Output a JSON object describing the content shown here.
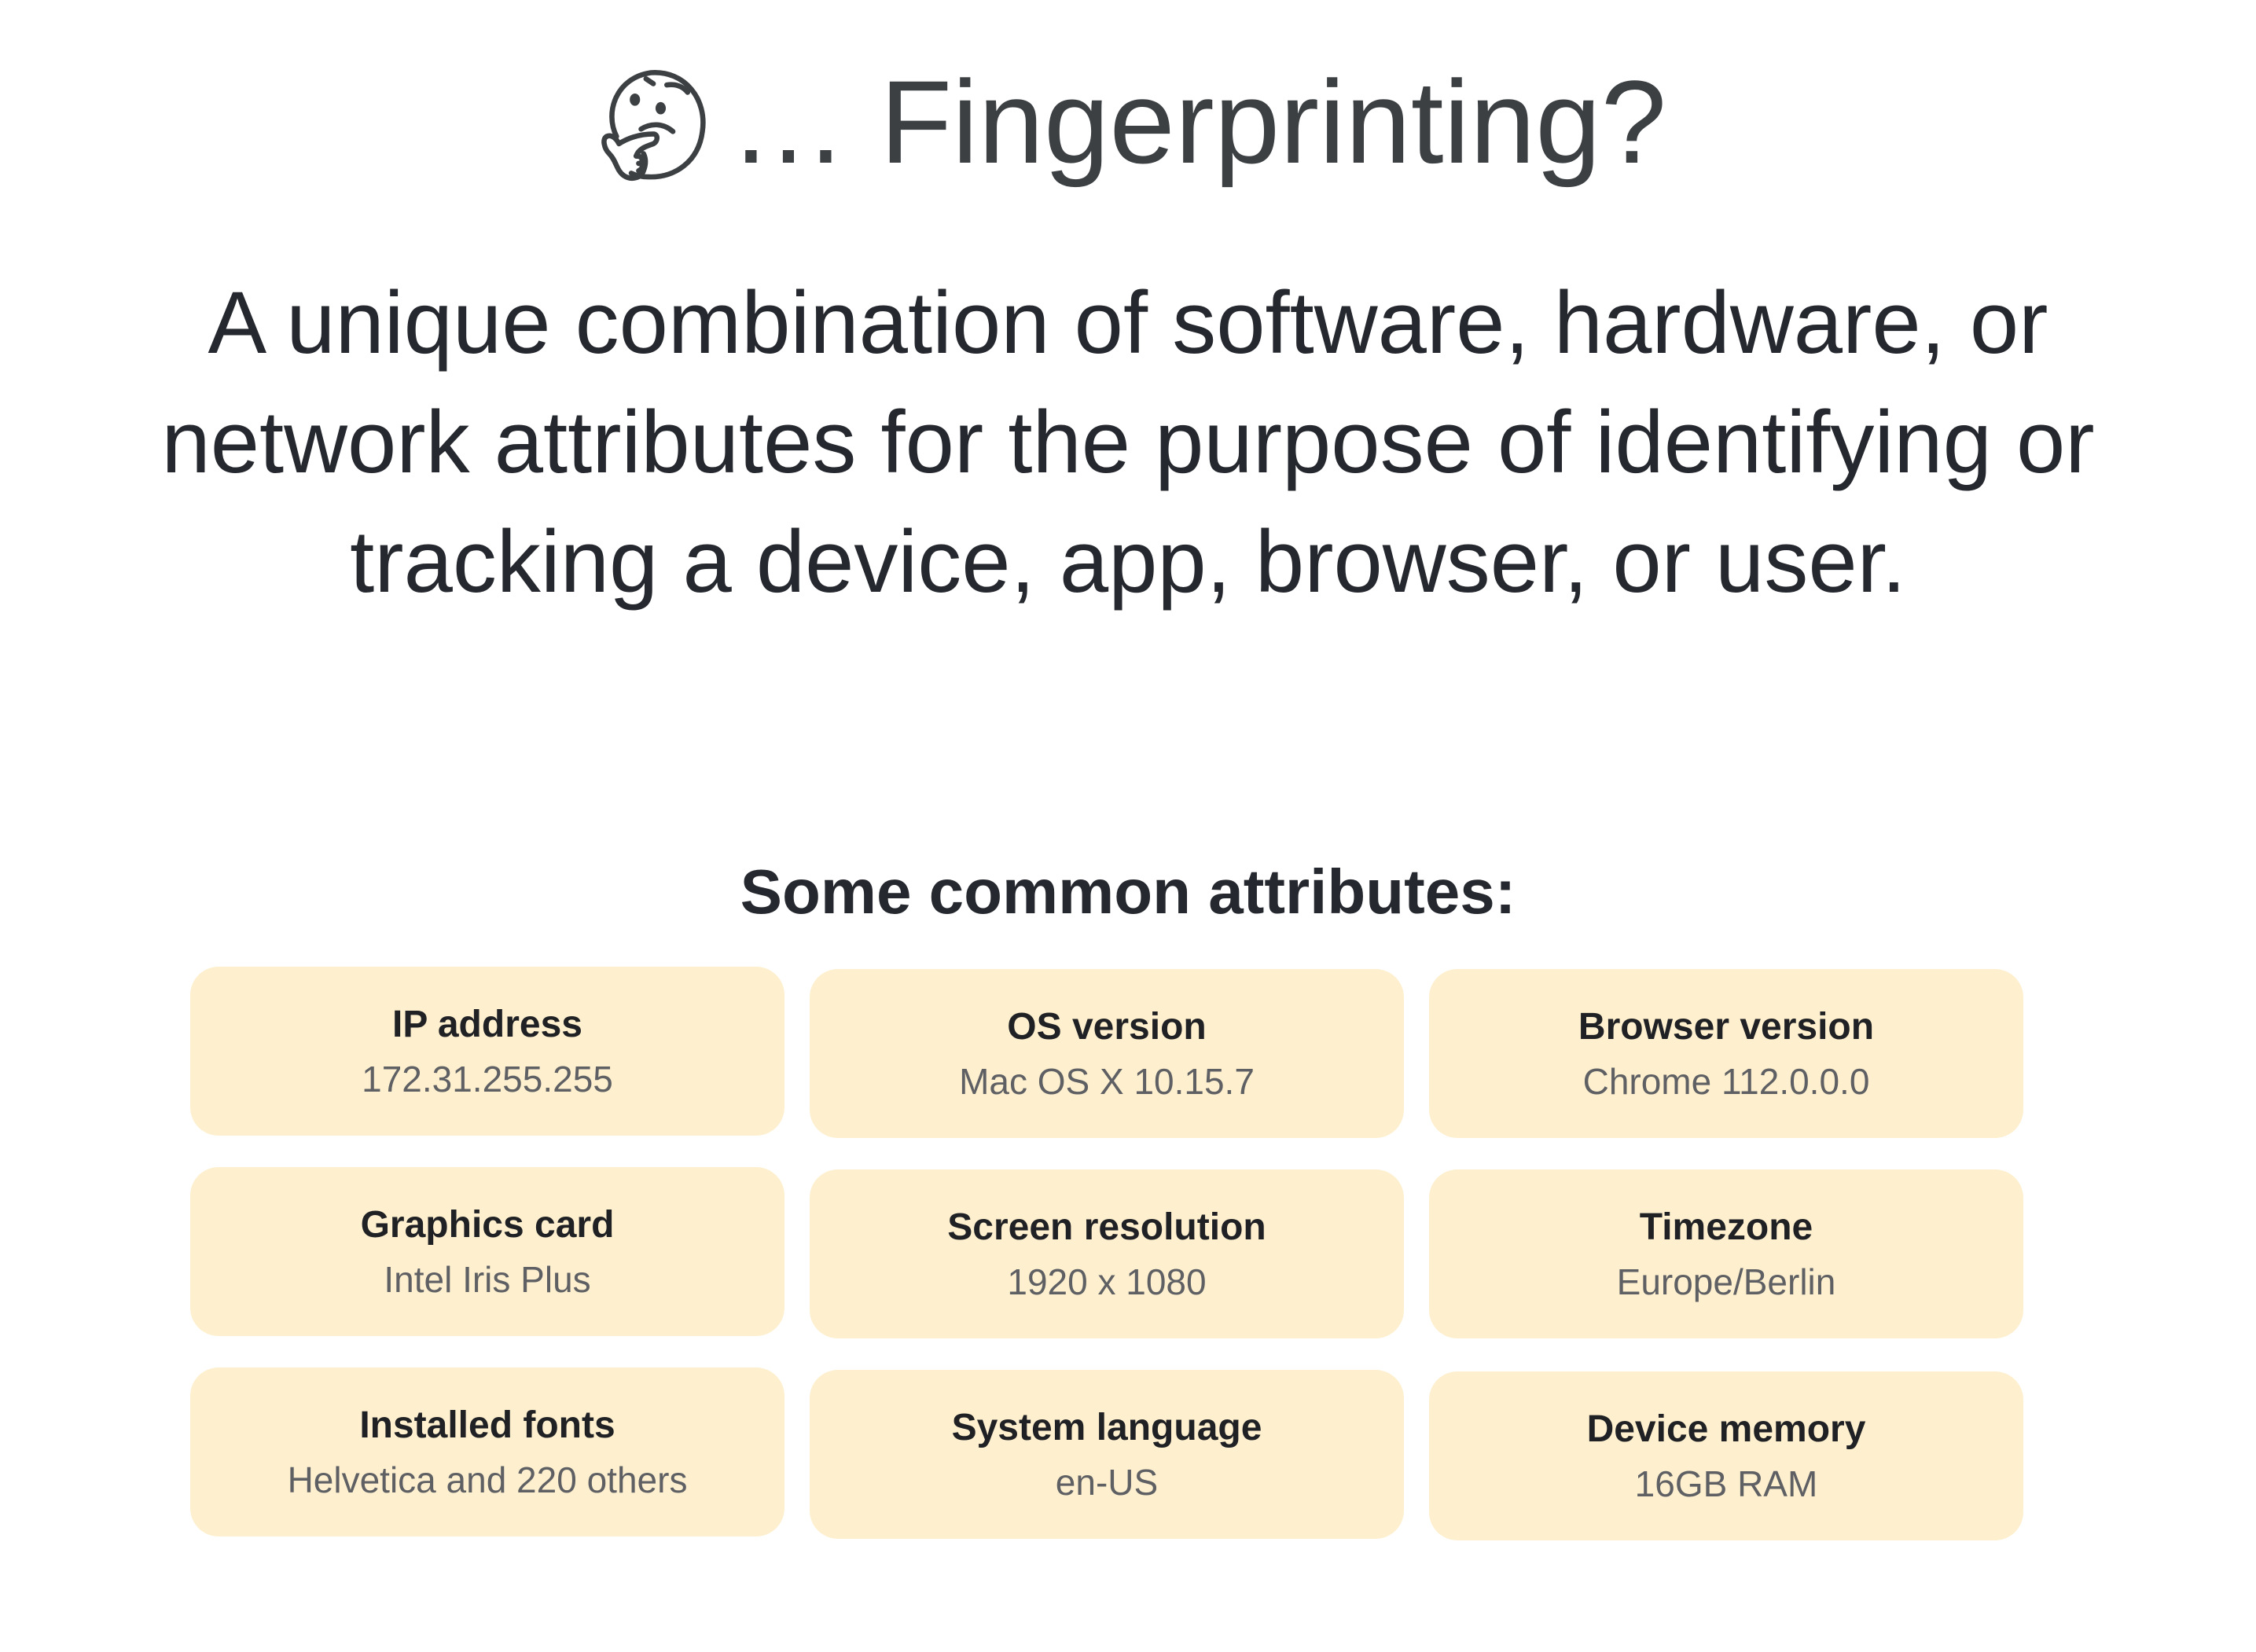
{
  "header": {
    "emoji_icon": "thinking-face-icon",
    "title": "… Fingerprinting?"
  },
  "definition": {
    "lines": [
      "A unique combination of software, hardware, or",
      "network attributes for the purpose of identifying or",
      "tracking a device, app, browser, or user."
    ]
  },
  "attributes": {
    "heading": "Some common attributes:",
    "card_color": "#fef0cf",
    "items": [
      {
        "label": "IP address",
        "value": "172.31.255.255"
      },
      {
        "label": "OS version",
        "value": "Mac OS X 10.15.7"
      },
      {
        "label": "Browser version",
        "value": "Chrome 112.0.0.0"
      },
      {
        "label": "Graphics card",
        "value": "Intel Iris Plus"
      },
      {
        "label": "Screen resolution",
        "value": "1920 x 1080"
      },
      {
        "label": "Timezone",
        "value": "Europe/Berlin"
      },
      {
        "label": "Installed fonts",
        "value": "Helvetica and 220 others"
      },
      {
        "label": "System language",
        "value": "en-US"
      },
      {
        "label": "Device memory",
        "value": "16GB RAM"
      }
    ]
  }
}
